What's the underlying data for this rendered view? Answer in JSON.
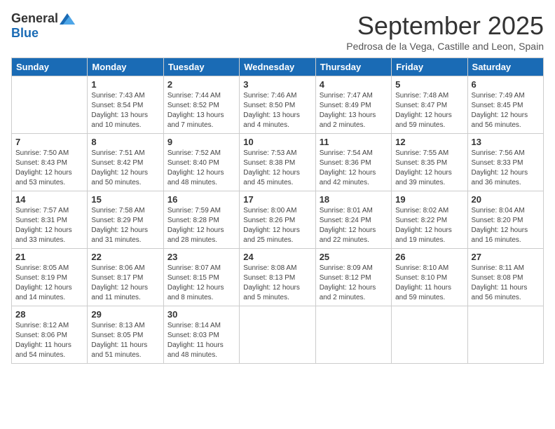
{
  "logo": {
    "general": "General",
    "blue": "Blue"
  },
  "title": "September 2025",
  "subtitle": "Pedrosa de la Vega, Castille and Leon, Spain",
  "weekdays": [
    "Sunday",
    "Monday",
    "Tuesday",
    "Wednesday",
    "Thursday",
    "Friday",
    "Saturday"
  ],
  "weeks": [
    [
      {
        "day": "",
        "info": ""
      },
      {
        "day": "1",
        "info": "Sunrise: 7:43 AM\nSunset: 8:54 PM\nDaylight: 13 hours\nand 10 minutes."
      },
      {
        "day": "2",
        "info": "Sunrise: 7:44 AM\nSunset: 8:52 PM\nDaylight: 13 hours\nand 7 minutes."
      },
      {
        "day": "3",
        "info": "Sunrise: 7:46 AM\nSunset: 8:50 PM\nDaylight: 13 hours\nand 4 minutes."
      },
      {
        "day": "4",
        "info": "Sunrise: 7:47 AM\nSunset: 8:49 PM\nDaylight: 13 hours\nand 2 minutes."
      },
      {
        "day": "5",
        "info": "Sunrise: 7:48 AM\nSunset: 8:47 PM\nDaylight: 12 hours\nand 59 minutes."
      },
      {
        "day": "6",
        "info": "Sunrise: 7:49 AM\nSunset: 8:45 PM\nDaylight: 12 hours\nand 56 minutes."
      }
    ],
    [
      {
        "day": "7",
        "info": "Sunrise: 7:50 AM\nSunset: 8:43 PM\nDaylight: 12 hours\nand 53 minutes."
      },
      {
        "day": "8",
        "info": "Sunrise: 7:51 AM\nSunset: 8:42 PM\nDaylight: 12 hours\nand 50 minutes."
      },
      {
        "day": "9",
        "info": "Sunrise: 7:52 AM\nSunset: 8:40 PM\nDaylight: 12 hours\nand 48 minutes."
      },
      {
        "day": "10",
        "info": "Sunrise: 7:53 AM\nSunset: 8:38 PM\nDaylight: 12 hours\nand 45 minutes."
      },
      {
        "day": "11",
        "info": "Sunrise: 7:54 AM\nSunset: 8:36 PM\nDaylight: 12 hours\nand 42 minutes."
      },
      {
        "day": "12",
        "info": "Sunrise: 7:55 AM\nSunset: 8:35 PM\nDaylight: 12 hours\nand 39 minutes."
      },
      {
        "day": "13",
        "info": "Sunrise: 7:56 AM\nSunset: 8:33 PM\nDaylight: 12 hours\nand 36 minutes."
      }
    ],
    [
      {
        "day": "14",
        "info": "Sunrise: 7:57 AM\nSunset: 8:31 PM\nDaylight: 12 hours\nand 33 minutes."
      },
      {
        "day": "15",
        "info": "Sunrise: 7:58 AM\nSunset: 8:29 PM\nDaylight: 12 hours\nand 31 minutes."
      },
      {
        "day": "16",
        "info": "Sunrise: 7:59 AM\nSunset: 8:28 PM\nDaylight: 12 hours\nand 28 minutes."
      },
      {
        "day": "17",
        "info": "Sunrise: 8:00 AM\nSunset: 8:26 PM\nDaylight: 12 hours\nand 25 minutes."
      },
      {
        "day": "18",
        "info": "Sunrise: 8:01 AM\nSunset: 8:24 PM\nDaylight: 12 hours\nand 22 minutes."
      },
      {
        "day": "19",
        "info": "Sunrise: 8:02 AM\nSunset: 8:22 PM\nDaylight: 12 hours\nand 19 minutes."
      },
      {
        "day": "20",
        "info": "Sunrise: 8:04 AM\nSunset: 8:20 PM\nDaylight: 12 hours\nand 16 minutes."
      }
    ],
    [
      {
        "day": "21",
        "info": "Sunrise: 8:05 AM\nSunset: 8:19 PM\nDaylight: 12 hours\nand 14 minutes."
      },
      {
        "day": "22",
        "info": "Sunrise: 8:06 AM\nSunset: 8:17 PM\nDaylight: 12 hours\nand 11 minutes."
      },
      {
        "day": "23",
        "info": "Sunrise: 8:07 AM\nSunset: 8:15 PM\nDaylight: 12 hours\nand 8 minutes."
      },
      {
        "day": "24",
        "info": "Sunrise: 8:08 AM\nSunset: 8:13 PM\nDaylight: 12 hours\nand 5 minutes."
      },
      {
        "day": "25",
        "info": "Sunrise: 8:09 AM\nSunset: 8:12 PM\nDaylight: 12 hours\nand 2 minutes."
      },
      {
        "day": "26",
        "info": "Sunrise: 8:10 AM\nSunset: 8:10 PM\nDaylight: 11 hours\nand 59 minutes."
      },
      {
        "day": "27",
        "info": "Sunrise: 8:11 AM\nSunset: 8:08 PM\nDaylight: 11 hours\nand 56 minutes."
      }
    ],
    [
      {
        "day": "28",
        "info": "Sunrise: 8:12 AM\nSunset: 8:06 PM\nDaylight: 11 hours\nand 54 minutes."
      },
      {
        "day": "29",
        "info": "Sunrise: 8:13 AM\nSunset: 8:05 PM\nDaylight: 11 hours\nand 51 minutes."
      },
      {
        "day": "30",
        "info": "Sunrise: 8:14 AM\nSunset: 8:03 PM\nDaylight: 11 hours\nand 48 minutes."
      },
      {
        "day": "",
        "info": ""
      },
      {
        "day": "",
        "info": ""
      },
      {
        "day": "",
        "info": ""
      },
      {
        "day": "",
        "info": ""
      }
    ]
  ]
}
